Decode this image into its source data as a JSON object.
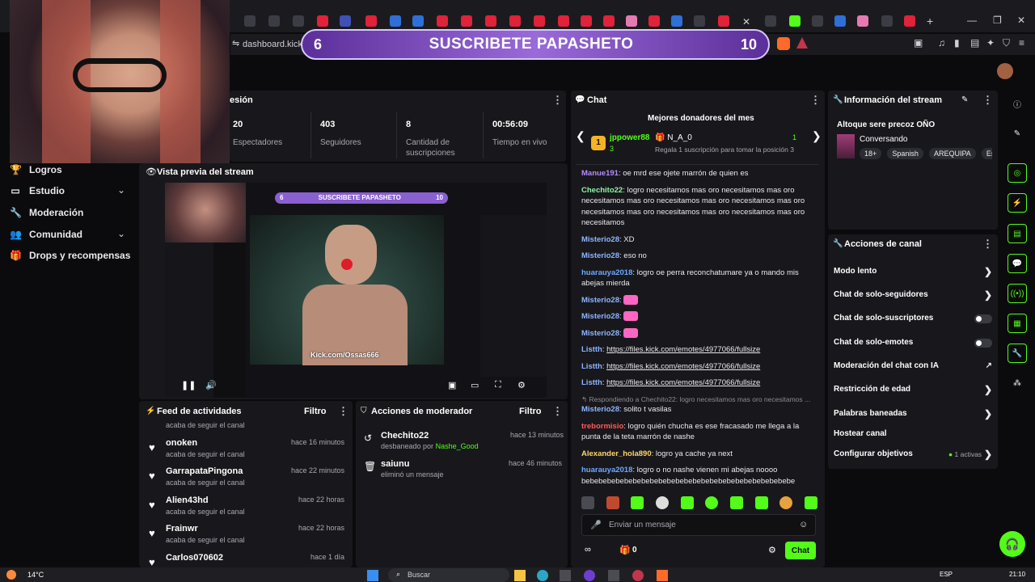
{
  "browser": {
    "url": "dashboard.kick.",
    "weather": "14°C",
    "search": "Buscar",
    "lang": "ESP",
    "clock": "21:10"
  },
  "banner": {
    "left_count": "6",
    "text": "SUSCRIBETE PAPASHETO",
    "right_count": "10"
  },
  "nav": [
    {
      "label": "Logros",
      "icon": "trophy-icon"
    },
    {
      "label": "Estudio",
      "icon": "studio-icon"
    },
    {
      "label": "Moderación",
      "icon": "wrench-icon"
    },
    {
      "label": "Comunidad",
      "icon": "people-icon"
    },
    {
      "label": "Drops y recompensas",
      "icon": "gift-icon"
    }
  ],
  "session": {
    "title_partial": "esión",
    "stats": [
      {
        "value": "20",
        "label": "Espectadores"
      },
      {
        "value": "403",
        "label": "Seguidores"
      },
      {
        "value": "8",
        "label": "Cantidad de suscripciones"
      },
      {
        "value": "00:56:09",
        "label": "Tiempo en vivo"
      }
    ]
  },
  "preview": {
    "title": "Vista previa del stream",
    "inner_banner": "SUSCRIBETE PAPASHETO",
    "inner_left": "6",
    "inner_right": "10",
    "watermark": "Kick.com/Ossas666"
  },
  "feed": {
    "title": "Feed de actividades",
    "filter": "Filtro",
    "top_partial": "acaba de seguir el canal",
    "items": [
      {
        "user": "onoken",
        "action": "acaba de seguir el canal",
        "time": "hace 16 minutos"
      },
      {
        "user": "GarrapataPingona",
        "action": "acaba de seguir el canal",
        "time": "hace 22 minutos"
      },
      {
        "user": "Alien43hd",
        "action": "acaba de seguir el canal",
        "time": "hace 22 horas"
      },
      {
        "user": "Frainwr",
        "action": "acaba de seguir el canal",
        "time": "hace 22 horas"
      },
      {
        "user": "Carlos070602",
        "action": "",
        "time": "hace 1 día"
      }
    ]
  },
  "mod_actions": {
    "title": "Acciones de moderador",
    "filter": "Filtro",
    "items": [
      {
        "user": "Chechito22",
        "action": "desbaneado por",
        "by": "Nashe_Good",
        "time": "hace 13 minutos"
      },
      {
        "user": "saiunu",
        "action": "eliminó un mensaje",
        "by": "",
        "time": "hace 46 minutos"
      }
    ]
  },
  "chat": {
    "title": "Chat",
    "donors_title": "Mejores donadores del mes",
    "donor1": {
      "rank": "1",
      "name": "jppower88",
      "count": "3"
    },
    "donor2": {
      "name": "N_A_0",
      "count": "1",
      "note": "Regala 1 suscripción para tomar la posición 3"
    },
    "messages": [
      {
        "user": "Manue191",
        "color": "#b48cff",
        "text": "oe mrd ese ojete marrón de quien es"
      },
      {
        "user": "Chechito22",
        "color": "#8cf5a0",
        "text": "logro necesitamos mas oro necesitamos mas oro necesitamos mas oro necesitamos mas oro necesitamos mas oro necesitamos mas oro necesitamos mas oro necesitamos mas oro necesitamos"
      },
      {
        "user": "Misterio28",
        "color": "#8fb4ff",
        "text": "XD"
      },
      {
        "user": "Misterio28",
        "color": "#8fb4ff",
        "text": "eso no"
      },
      {
        "user": "huarauya2018",
        "color": "#6fa8ff",
        "text": "logro oe perra reconchatumare ya o mando mis abejas mierda"
      },
      {
        "user": "Misterio28",
        "color": "#8fb4ff",
        "text": "",
        "emote": true
      },
      {
        "user": "Misterio28",
        "color": "#8fb4ff",
        "text": "",
        "emote": true
      },
      {
        "user": "Misterio28",
        "color": "#8fb4ff",
        "text": "",
        "emote": true
      },
      {
        "user": "Listth",
        "color": "#8fb4ff",
        "text": "https://files.kick.com/emotes/4977066/fullsize",
        "link": true
      },
      {
        "user": "Listth",
        "color": "#8fb4ff",
        "text": "https://files.kick.com/emotes/4977066/fullsize",
        "link": true
      },
      {
        "user": "Listth",
        "color": "#8fb4ff",
        "text": "https://files.kick.com/emotes/4977066/fullsize",
        "link": true
      }
    ],
    "reply_note": "Respondiendo a Chechito22: logro necesitamos mas oro necesitamos ...",
    "messages2": [
      {
        "user": "Misterio28",
        "color": "#8fb4ff",
        "text": "solito t vasilas"
      },
      {
        "user": "trebormisio",
        "color": "#ff5a5a",
        "text": "logro quién chucha es ese fracasado me llega a la punta de la teta marrón de nashe"
      },
      {
        "user": "Alexander_hola890",
        "color": "#ffd66b",
        "text": "logro ya cache ya next"
      },
      {
        "user": "huarauya2018",
        "color": "#6fa8ff",
        "text": "logro o no nashe vienen mi abejas noooo bebebebebebebebebebebebebebebebebebebebebebebebebe"
      }
    ],
    "input_placeholder": "Enviar un mensaje",
    "points": "0",
    "send_label": "Chat"
  },
  "stream_info": {
    "title": "Información del stream",
    "stream_title": "Altoque sere precoz OÑO",
    "category": "Conversando",
    "tags": [
      "18+",
      "Spanish",
      "AREQUIPA",
      "Es"
    ]
  },
  "channel_actions": {
    "title": "Acciones de canal",
    "items": [
      {
        "label": "Modo lento",
        "control": "chevron"
      },
      {
        "label": "Chat de solo-seguidores",
        "control": "chevron"
      },
      {
        "label": "Chat de solo-suscriptores",
        "control": "toggle"
      },
      {
        "label": "Chat de solo-emotes",
        "control": "toggle"
      },
      {
        "label": "Moderación del chat con IA",
        "control": "external"
      },
      {
        "label": "Restricción de edad",
        "control": "chevron"
      },
      {
        "label": "Palabras baneadas",
        "control": "chevron"
      },
      {
        "label": "Hostear canal",
        "control": "none"
      },
      {
        "label": "Configurar objetivos",
        "control": "chevron",
        "badge": "1 activas"
      }
    ]
  }
}
